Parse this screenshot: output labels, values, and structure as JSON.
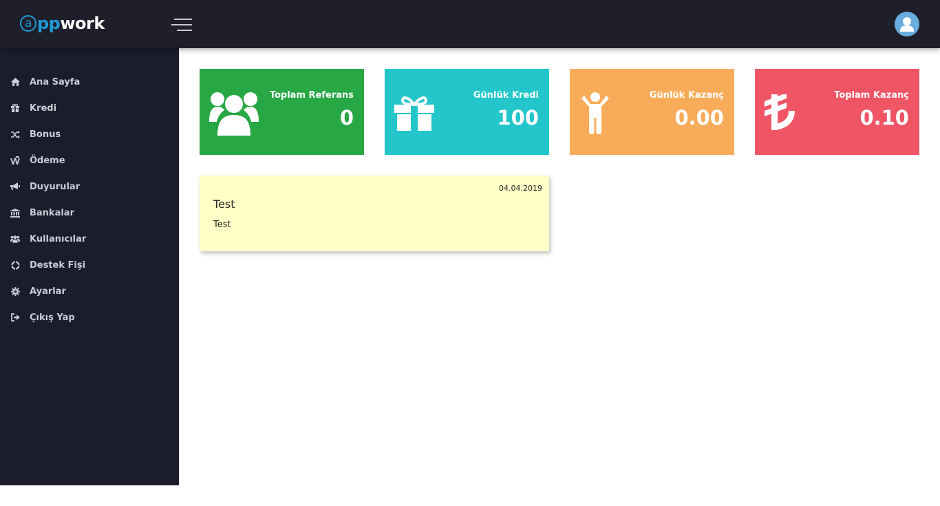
{
  "header": {
    "logo_at": "a",
    "logo_pp": "pp",
    "logo_rest": "work",
    "menu_icon": "hamburger-icon",
    "avatar_icon": "user-avatar-icon"
  },
  "sidebar": {
    "items": [
      {
        "label": "Ana Sayfa",
        "icon": "home-icon"
      },
      {
        "label": "Kredi",
        "icon": "gift-icon"
      },
      {
        "label": "Bonus",
        "icon": "shuffle-icon"
      },
      {
        "label": "Ödeme",
        "icon": "payment-icon"
      },
      {
        "label": "Duyurular",
        "icon": "megaphone-icon"
      },
      {
        "label": "Bankalar",
        "icon": "bank-icon"
      },
      {
        "label": "Kullanıcılar",
        "icon": "users-icon"
      },
      {
        "label": "Destek Fişi",
        "icon": "lifebuoy-icon"
      },
      {
        "label": "Ayarlar",
        "icon": "gear-icon"
      },
      {
        "label": "Çıkış Yap",
        "icon": "sign-out-icon"
      }
    ]
  },
  "cards": [
    {
      "title": "Toplam Referans",
      "value": "0",
      "color": "#28a745",
      "icon": "users-icon"
    },
    {
      "title": "Günlük Kredi",
      "value": "100",
      "color": "#22c6cb",
      "icon": "gift-icon"
    },
    {
      "title": "Günlük Kazanç",
      "value": "0.00",
      "color": "#f8ac5a",
      "icon": "child-icon"
    },
    {
      "title": "Toplam Kazanç",
      "value": "0.10",
      "color": "#ef5565",
      "icon": "lira-icon"
    }
  ],
  "note": {
    "date": "04.04.2019",
    "title": "Test",
    "body": "Test",
    "color": "#ffffc8"
  },
  "colors": {
    "topbar": "#1f1f2c",
    "sidebar": "#1c1d2b",
    "brand_blue": "#1e9bd7",
    "nav_text": "#c9cbd6"
  }
}
